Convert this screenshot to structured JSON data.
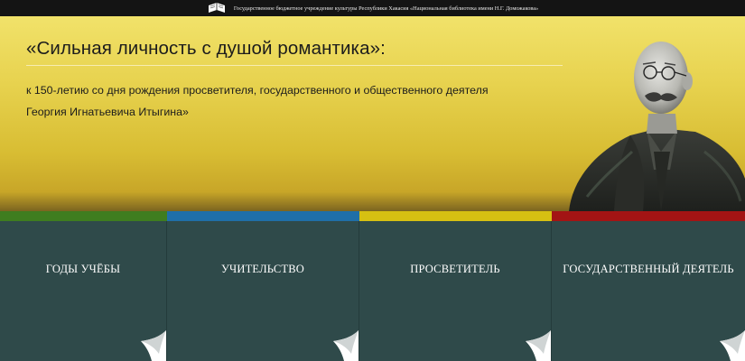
{
  "header": {
    "org_name": "Государственное бюджетное учреждение культуры Республики Хакасия «Национальная библиотека имени Н.Г. Доможакова»",
    "logo_icon": "book-logo-icon"
  },
  "hero": {
    "title": "«Сильная личность с душой романтика»:",
    "subtitle_line1": "к 150-летию со дня рождения просветителя, государственного и общественного деятеля",
    "subtitle_line2": "Георгия Игнатьевича Итыгина»",
    "portrait_icon": "portrait-illustration"
  },
  "stripes": [
    {
      "color": "#3f7d1f"
    },
    {
      "color": "#1f6fa8"
    },
    {
      "color": "#d6c012"
    },
    {
      "color": "#a31414"
    }
  ],
  "cards": [
    {
      "label": "ГОДЫ УЧЁБЫ"
    },
    {
      "label": "УЧИТЕЛЬСТВО"
    },
    {
      "label": "ПРОСВЕТИТЕЛЬ"
    },
    {
      "label": "ГОСУДАРСТВЕННЫЙ ДЕЯТЕЛЬ"
    }
  ],
  "colors": {
    "card_bg": "#2f4a4a",
    "hero_gold": "#e7d24e",
    "topbar": "#141414"
  }
}
